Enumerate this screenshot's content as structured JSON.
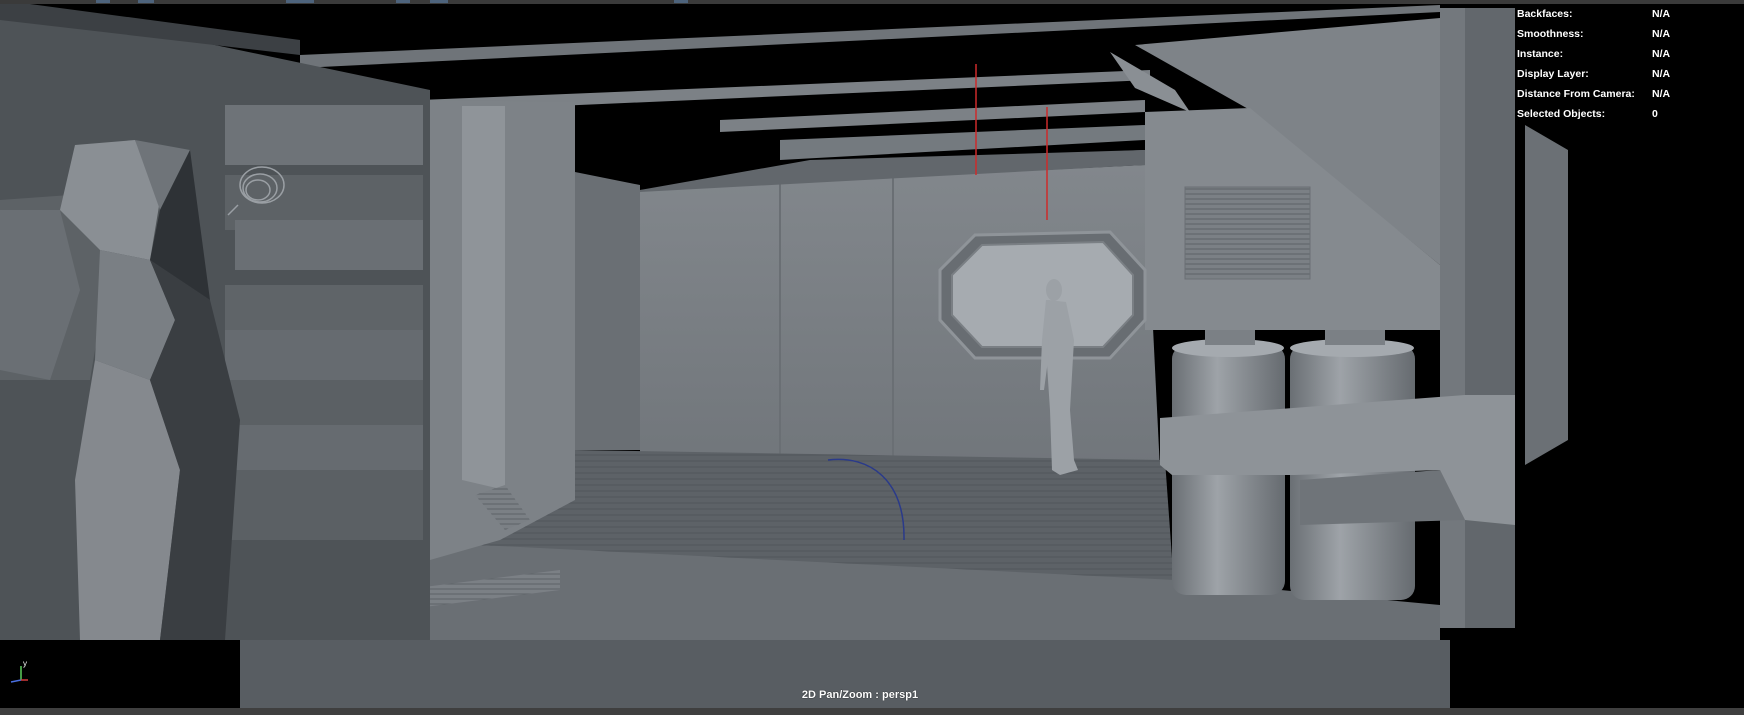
{
  "viewport": {
    "camera_label": "2D Pan/Zoom : persp1",
    "background": "#1a1a1a"
  },
  "hud": {
    "rows": [
      {
        "label": "Backfaces:",
        "value": "N/A"
      },
      {
        "label": "Smoothness:",
        "value": "N/A"
      },
      {
        "label": "Instance:",
        "value": "N/A"
      },
      {
        "label": "Display Layer:",
        "value": "N/A"
      },
      {
        "label": "Distance From Camera:",
        "value": "N/A"
      },
      {
        "label": "Selected Objects:",
        "value": "0"
      }
    ]
  },
  "axis_gizmo": {
    "y_label": "y",
    "x_color": "#d23a3a",
    "y_color": "#5ccf5c",
    "z_color": "#4a6fe0"
  },
  "colors": {
    "mesh_light": "#7f8489",
    "mesh_mid": "#6a6f74",
    "mesh_dark": "#4e5357",
    "ceiling_void": "#000000",
    "light_line": "#cc2b2b",
    "curve": "#2a3a8a"
  }
}
